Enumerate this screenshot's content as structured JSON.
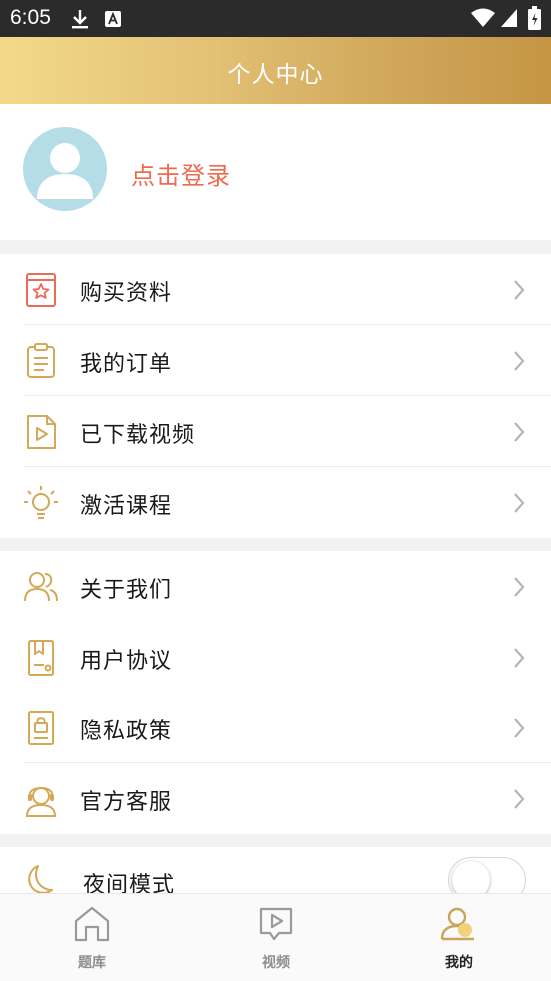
{
  "status_bar": {
    "time": "6:05"
  },
  "header": {
    "title": "个人中心"
  },
  "profile": {
    "login_text": "点击登录"
  },
  "menu_group_1": [
    {
      "label": "购买资料",
      "icon": "purchase-materials-icon"
    },
    {
      "label": "我的订单",
      "icon": "orders-icon"
    },
    {
      "label": "已下载视频",
      "icon": "downloaded-video-icon"
    },
    {
      "label": "激活课程",
      "icon": "activate-course-icon"
    }
  ],
  "menu_group_2": [
    {
      "label": "关于我们",
      "icon": "about-us-icon"
    },
    {
      "label": "用户协议",
      "icon": "user-agreement-icon"
    },
    {
      "label": "隐私政策",
      "icon": "privacy-policy-icon"
    },
    {
      "label": "官方客服",
      "icon": "customer-service-icon"
    }
  ],
  "night_mode": {
    "label": "夜间模式",
    "enabled": false,
    "icon": "moon-icon"
  },
  "tabbar": {
    "tabs": [
      {
        "label": "题库",
        "icon": "home-icon",
        "active": false
      },
      {
        "label": "视频",
        "icon": "video-icon",
        "active": false
      },
      {
        "label": "我的",
        "icon": "profile-icon",
        "active": true
      }
    ]
  },
  "colors": {
    "accent_gold": "#d4a857",
    "login_red": "#ef6a4c",
    "purchase_icon_red": "#ec6a58",
    "avatar_blue": "#b4dde8"
  }
}
